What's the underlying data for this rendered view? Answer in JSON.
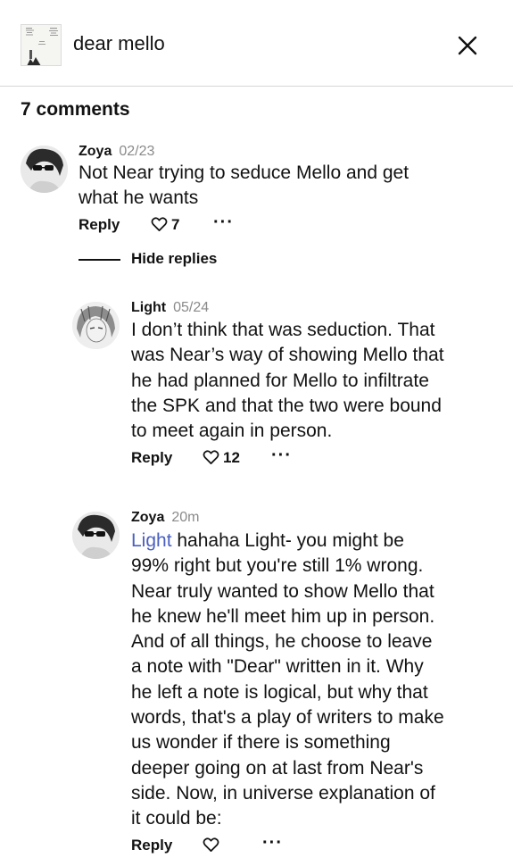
{
  "header": {
    "story_title": "dear mello",
    "cover_icon": "story-cover-icon",
    "close_icon": "close-icon"
  },
  "comments_count_label": "7 comments",
  "hide_replies_label": "Hide replies",
  "colors": {
    "mention": "#4a5fc1",
    "text": "#121212",
    "meta": "#8a8a8a"
  },
  "comments": [
    {
      "author": "Zoya",
      "date": "02/23",
      "lines": [
        "Not Near trying to seduce Mello and get",
        "what he wants"
      ],
      "reply_label": "Reply",
      "like_count": "7",
      "more_label": "···"
    },
    {
      "author": "Light",
      "date": "05/24",
      "lines": [
        "I don’t think that was seduction. That",
        "was Near’s way of showing Mello that",
        "he had planned for Mello to infiltrate",
        "the SPK and that the two were bound",
        "to meet again in person."
      ],
      "reply_label": "Reply",
      "like_count": "12",
      "more_label": "···"
    },
    {
      "author": "Zoya",
      "date": "20m",
      "mention": "Light",
      "first_line_rest": " hahaha Light- you might be",
      "lines": [
        "99% right but you're still 1% wrong.",
        "Near truly wanted to show Mello that",
        "he knew he'll meet him up in person.",
        "And of all things, he choose to leave",
        "a note with \"Dear\" written in it. Why",
        "he left a note is logical, but why that",
        "words, that's a play of writers to make",
        "us wonder if there is something",
        "deeper going on at last from Near's",
        "side. Now, in universe explanation of",
        "it could be:"
      ],
      "reply_label": "Reply",
      "like_count": "",
      "more_label": "···"
    }
  ]
}
